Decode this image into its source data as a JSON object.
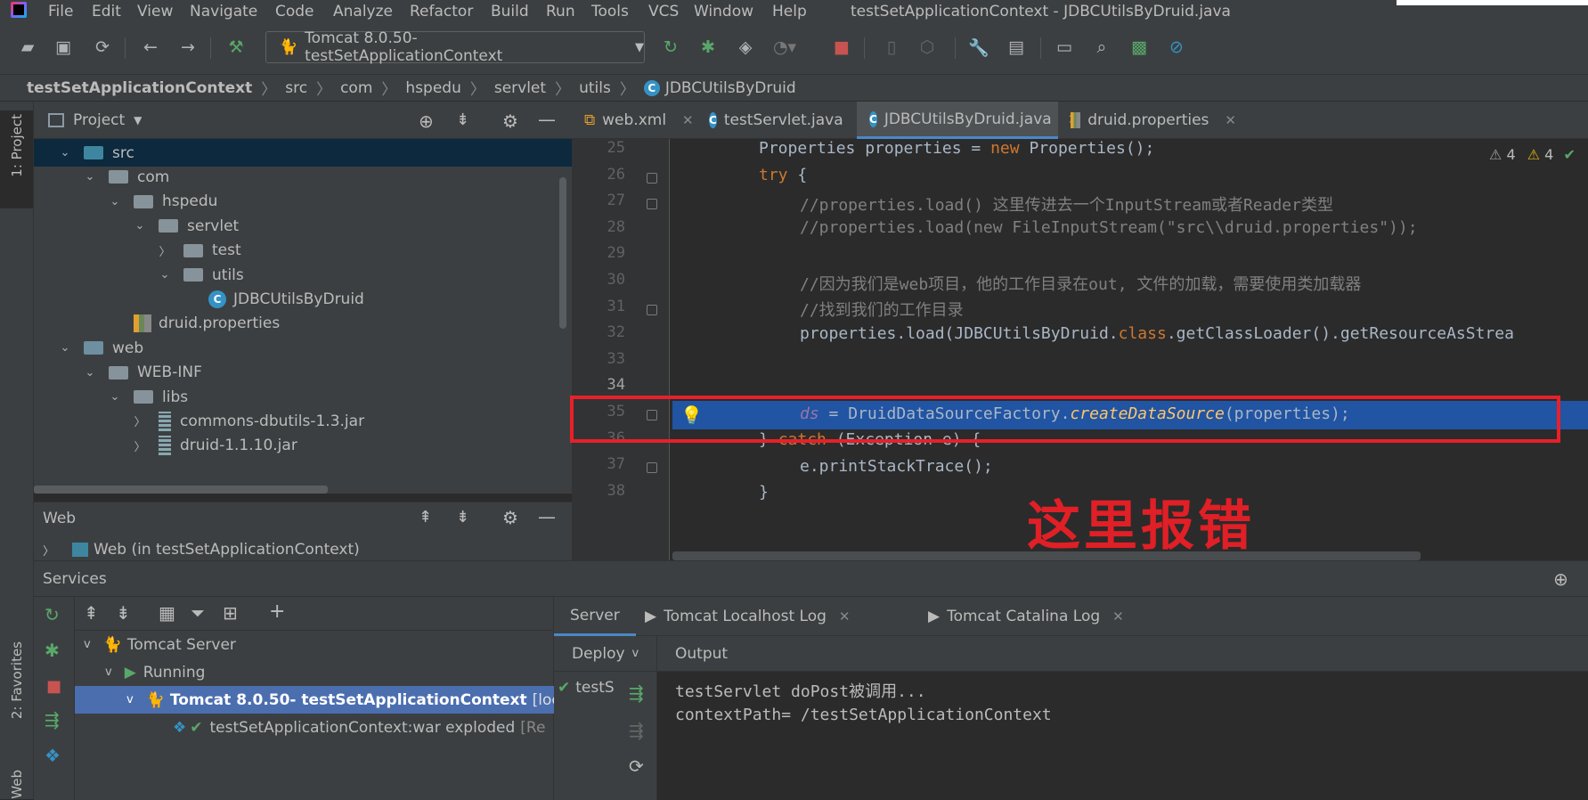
{
  "menu": {
    "items": [
      "File",
      "Edit",
      "View",
      "Navigate",
      "Code",
      "Analyze",
      "Refactor",
      "Build",
      "Run",
      "Tools",
      "VCS",
      "Window",
      "Help"
    ],
    "title": "testSetApplicationContext - JDBCUtilsByDruid.java"
  },
  "toolbar": {
    "run_config": "Tomcat 8.0.50- testSetApplicationContext",
    "icons": [
      "open-icon",
      "save-icon",
      "sync-icon",
      "back-icon",
      "forward-icon",
      "build-hammer-icon",
      "rerun-icon",
      "debug-bug-icon",
      "coverage-icon",
      "profile-icon",
      "stop-icon",
      "attach-icon",
      "settings-wrench-icon",
      "project-structure-icon",
      "terminal-icon",
      "search-icon",
      "monitor-icon",
      "no-power-save-icon"
    ]
  },
  "breadcrumb": [
    "testSetApplicationContext",
    "src",
    "com",
    "hspedu",
    "servlet",
    "utils",
    "JDBCUtilsByDruid"
  ],
  "left_strip": {
    "project": "1: Project",
    "favorites": "2: Favorites",
    "web": "Web"
  },
  "project": {
    "header": "Project",
    "tree": [
      {
        "label": "src",
        "depth": 1,
        "arrow": "v",
        "icon": "folder-blue",
        "selected": true
      },
      {
        "label": "com",
        "depth": 2,
        "arrow": "v",
        "icon": "package"
      },
      {
        "label": "hspedu",
        "depth": 3,
        "arrow": "v",
        "icon": "package"
      },
      {
        "label": "servlet",
        "depth": 4,
        "arrow": "v",
        "icon": "package"
      },
      {
        "label": "test",
        "depth": 5,
        "arrow": ">",
        "icon": "package"
      },
      {
        "label": "utils",
        "depth": 5,
        "arrow": "v",
        "icon": "package"
      },
      {
        "label": "JDBCUtilsByDruid",
        "depth": 6,
        "arrow": "",
        "icon": "class"
      },
      {
        "label": "druid.properties",
        "depth": 3,
        "arrow": "",
        "icon": "properties"
      },
      {
        "label": "web",
        "depth": 1,
        "arrow": "v",
        "icon": "folder-web"
      },
      {
        "label": "WEB-INF",
        "depth": 2,
        "arrow": "v",
        "icon": "folder"
      },
      {
        "label": "libs",
        "depth": 3,
        "arrow": "v",
        "icon": "folder"
      },
      {
        "label": "commons-dbutils-1.3.jar",
        "depth": 4,
        "arrow": ">",
        "icon": "jar"
      },
      {
        "label": "druid-1.1.10.jar",
        "depth": 4,
        "arrow": ">",
        "icon": "jar"
      }
    ]
  },
  "web_panel": {
    "header": "Web",
    "item": "Web (in testSetApplicationContext)"
  },
  "editor": {
    "tabs": [
      {
        "label": "web.xml",
        "icon": "xml"
      },
      {
        "label": "testServlet.java",
        "icon": "class"
      },
      {
        "label": "JDBCUtilsByDruid.java",
        "icon": "class",
        "active": true
      },
      {
        "label": "druid.properties",
        "icon": "properties"
      }
    ],
    "inspections": {
      "warnings_a": "4",
      "warnings_b": "4"
    },
    "lines": [
      {
        "n": "25"
      },
      {
        "n": "26"
      },
      {
        "n": "27"
      },
      {
        "n": "28"
      },
      {
        "n": "29"
      },
      {
        "n": "30"
      },
      {
        "n": "31"
      },
      {
        "n": "32"
      },
      {
        "n": "33"
      },
      {
        "n": "34"
      },
      {
        "n": "35"
      },
      {
        "n": "36"
      },
      {
        "n": "37"
      },
      {
        "n": "38"
      }
    ],
    "code": {
      "l25a": "Properties properties = ",
      "l25b": "new",
      "l25c": " Properties();",
      "l26a": "try",
      "l26b": " {",
      "l27": "//properties.load() 这里传进去一个InputStream或者Reader类型",
      "l28": "//properties.load(new FileInputStream(\"src\\\\druid.properties\"));",
      "l30": "//因为我们是web项目，他的工作目录在out, 文件的加载，需要使用类加载器",
      "l31": "//找到我们的工作目录",
      "l32a": "properties.load(JDBCUtilsByDruid.",
      "l32b": "class",
      "l32c": ".getClassLoader().getResourceAsStrea",
      "l34a": "ds",
      "l34b": " = DruidDataSourceFactory.",
      "l34c": "createDataSource",
      "l34d": "(properties);",
      "l35a": "} ",
      "l35b": "catch",
      "l35c": " (Exception e) {",
      "l36": "e.printStackTrace();",
      "l37": "}"
    },
    "annotation": "这里报错"
  },
  "services": {
    "header": "Services",
    "tree": [
      {
        "label": "Tomcat Server",
        "extra": ""
      },
      {
        "label": "Running",
        "extra": ""
      },
      {
        "label": "Tomcat 8.0.50- testSetApplicationContext",
        "extra": "[local]"
      },
      {
        "label": "testSetApplicationContext:war exploded",
        "extra": "[Re"
      }
    ],
    "tabs": {
      "server": "Server",
      "localhost_log": "Tomcat Localhost Log",
      "catalina_log": "Tomcat Catalina Log"
    },
    "deploy_header": "Deploy",
    "deploy_item": "testS",
    "output_header": "Output",
    "output": [
      "testServlet doPost被调用...",
      "contextPath= /testSetApplicationContext"
    ]
  },
  "colors": {
    "highlight": "#2154a2",
    "annotation_red": "#e8202a",
    "selection": "#4b6eaf"
  }
}
